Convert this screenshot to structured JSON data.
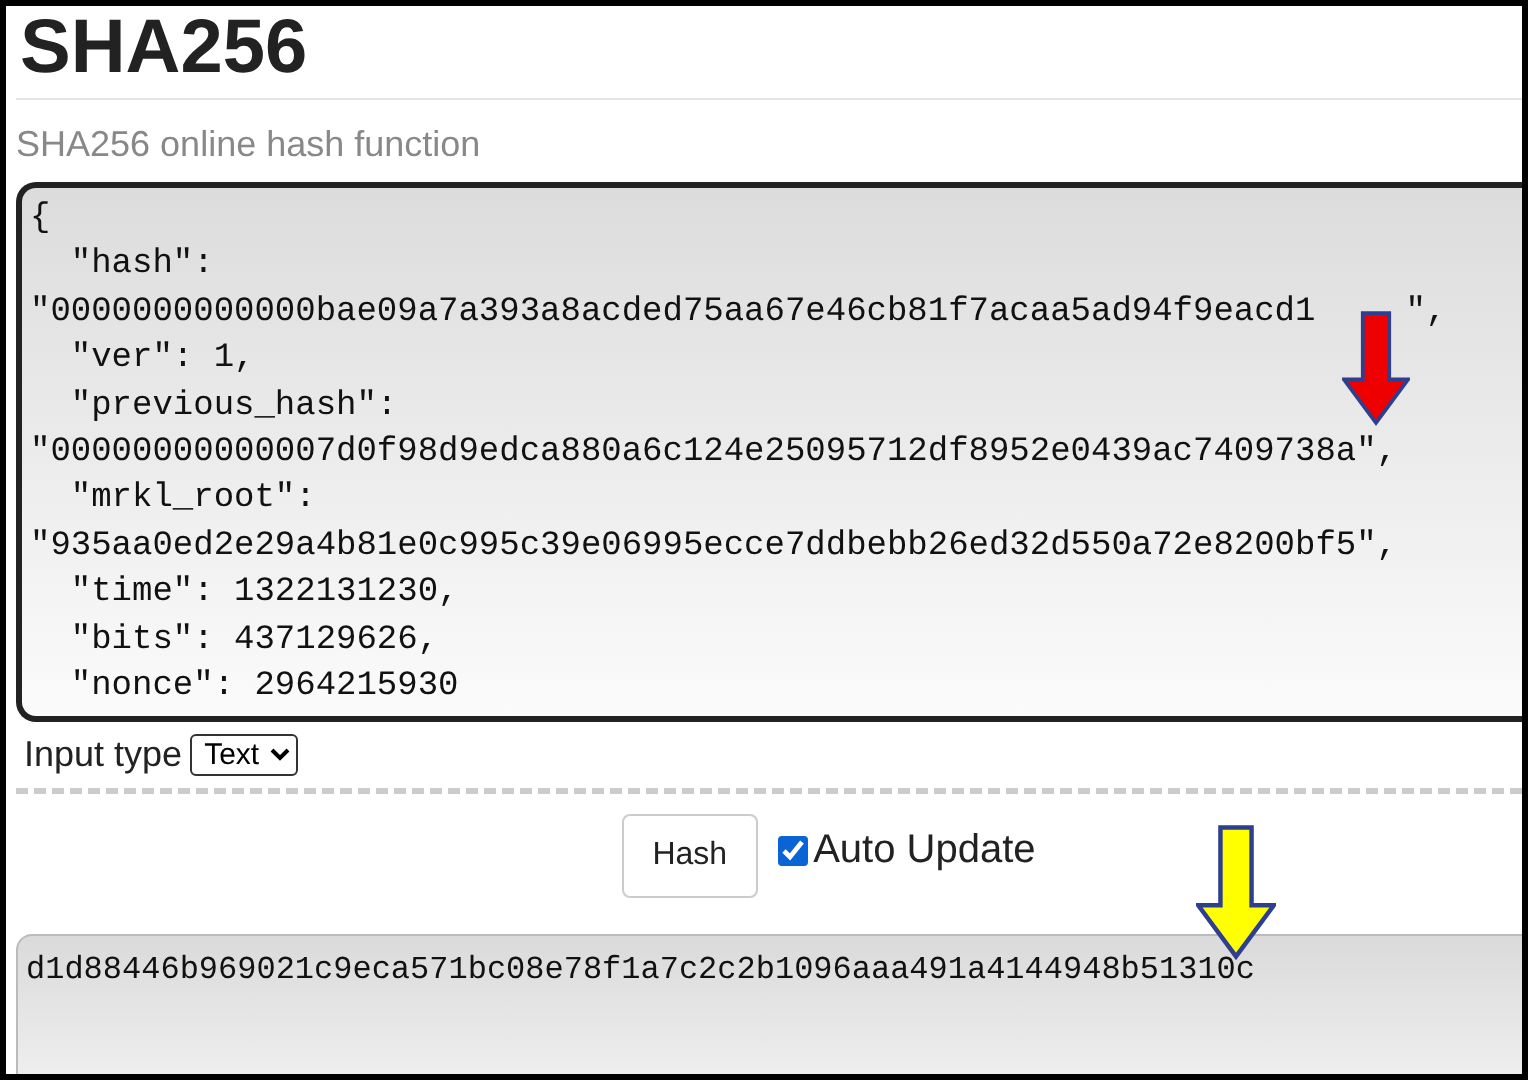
{
  "title": "SHA256",
  "subtitle": "SHA256 online hash function",
  "input": {
    "lines": [
      {
        "text": "{"
      },
      {
        "text": "  \"hash\":"
      },
      {
        "text": "\"0000000000000bae09a7a393a8acded75aa67e46cb81f7acaa5ad94f9eacd1",
        "tail": "\","
      },
      {
        "text": "  \"ver\": 1,"
      },
      {
        "text": "  \"previous_hash\":"
      },
      {
        "text": "\"00000000000007d0f98d9edca880a6c124e25095712df8952e0439ac7409738a\","
      },
      {
        "text": "  \"mrkl_root\":"
      },
      {
        "text": "\"935aa0ed2e29a4b81e0c995c39e06995ecce7ddbebb26ed32d550a72e8200bf5\","
      },
      {
        "text": "  \"time\": 1322131230,"
      },
      {
        "text": "  \"bits\": 437129626,"
      },
      {
        "text": "  \"nonce\": 2964215930"
      }
    ]
  },
  "input_type": {
    "label": "Input type",
    "value": "Text"
  },
  "hash_button": "Hash",
  "auto_update": {
    "label": "Auto Update",
    "checked": true
  },
  "output": "d1d88446b969021c9eca571bc08e78f1a7c2c2b1096aaa491a4144948b51310c"
}
